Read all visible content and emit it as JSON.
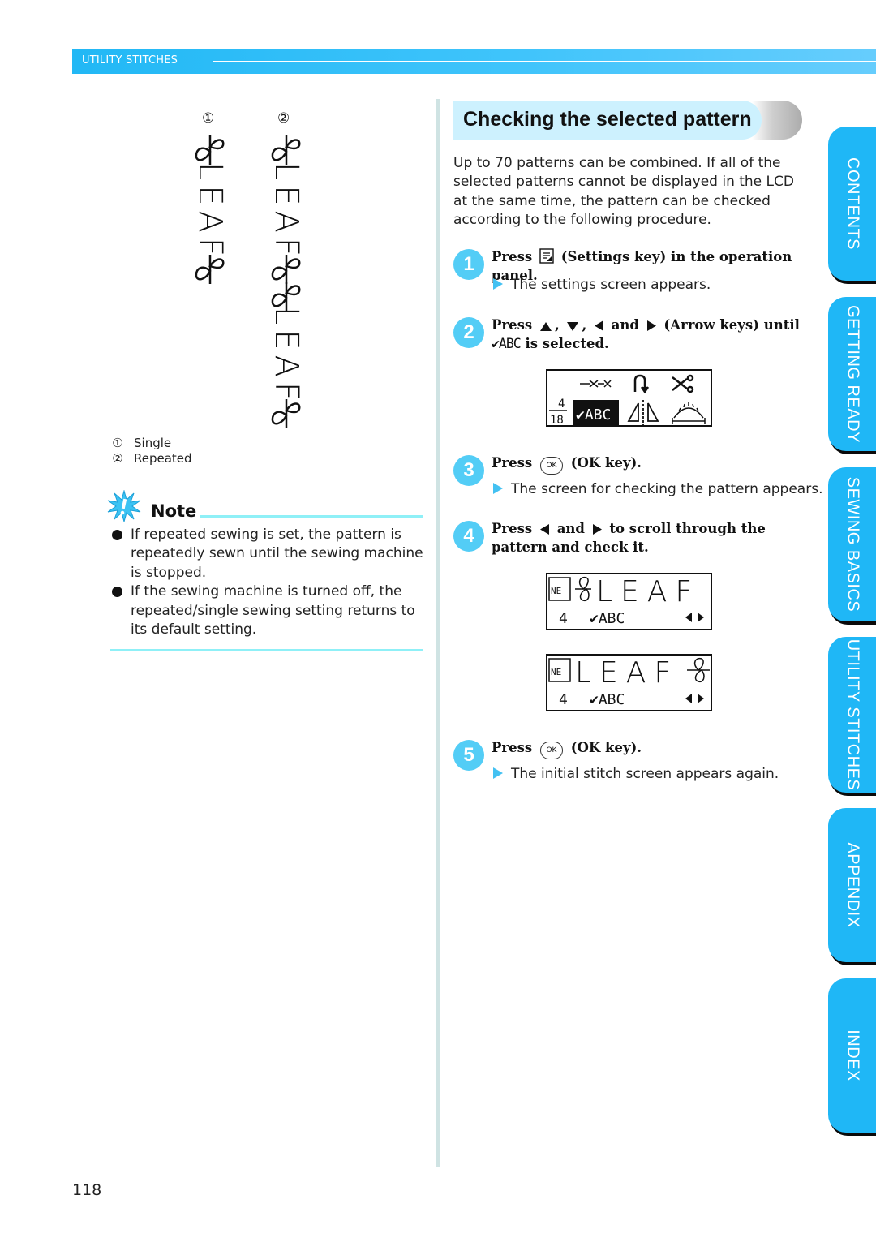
{
  "header": {
    "section": "UTILITY STITCHES"
  },
  "illustration": {
    "samples": [
      {
        "number": "①",
        "text": "LEAF"
      },
      {
        "number": "②",
        "text": "LEAF"
      }
    ],
    "legend": [
      {
        "number": "①",
        "label": "Single"
      },
      {
        "number": "②",
        "label": "Repeated"
      }
    ]
  },
  "note": {
    "title": "Note",
    "items": [
      "If repeated sewing is set, the pattern is repeatedly sewn until the sewing machine is stopped.",
      "If the sewing machine is turned off, the repeated/single sewing setting returns to its default setting."
    ]
  },
  "section": {
    "title": "Checking the selected pattern",
    "intro": "Up to 70 patterns can be combined. If all of the selected patterns cannot be displayed in the LCD at the same time, the pattern can be checked according to the following procedure."
  },
  "steps": [
    {
      "number": "1",
      "press": "Press",
      "after": "(Settings key) in the operation panel.",
      "result": "The settings screen appears."
    },
    {
      "number": "2",
      "press": "Press",
      "sep1": ",",
      "sep2": ",",
      "and": "and",
      "after": "(Arrow keys) until",
      "abc": "✔ABC",
      "after2": "is selected."
    },
    {
      "number": "3",
      "press": "Press",
      "ok": "OK",
      "after": "(OK key).",
      "result": "The screen for checking the pattern appears."
    },
    {
      "number": "4",
      "press": "Press",
      "and": "and",
      "after": "to scroll through the pattern and check it."
    },
    {
      "number": "5",
      "press": "Press",
      "ok": "OK",
      "after": "(OK key).",
      "result": "The initial stitch screen appears again."
    }
  ],
  "lcd_settings": {
    "fraction_top": "4",
    "fraction_bottom": "18",
    "selected": "✔ABC"
  },
  "lcd_check": [
    {
      "text": "LEAF",
      "count": "4",
      "mode": "✔ABC"
    },
    {
      "text": "LEAF",
      "count": "4",
      "mode": "✔ABC"
    }
  ],
  "side_tabs": [
    "CONTENTS",
    "GETTING READY",
    "SEWING BASICS",
    "UTILITY STITCHES",
    "APPENDIX",
    "INDEX"
  ],
  "page_number": "118"
}
